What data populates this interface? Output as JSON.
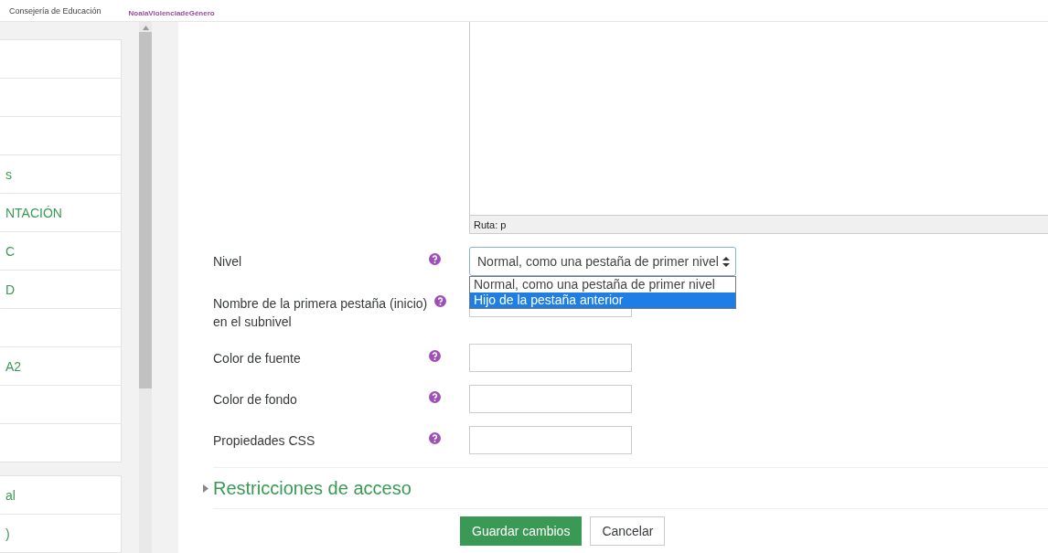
{
  "header": {
    "org": "Consejería de Educación",
    "campaign": "NoalaViolenciadeGénero"
  },
  "sidebar": {
    "panels": [
      {
        "items": [
          {
            "kind": "blank"
          },
          {
            "kind": "blank"
          },
          {
            "kind": "blank"
          },
          {
            "kind": "link",
            "label": "s"
          },
          {
            "kind": "link",
            "label": "NTACIÓN"
          },
          {
            "kind": "link",
            "label": "C"
          },
          {
            "kind": "link",
            "label": "D"
          },
          {
            "kind": "blank"
          },
          {
            "kind": "link",
            "label": "A2"
          },
          {
            "kind": "blank"
          },
          {
            "kind": "blank"
          }
        ]
      },
      {
        "items": [
          {
            "kind": "link",
            "label": "al"
          },
          {
            "kind": "link",
            "label": ")"
          }
        ]
      }
    ]
  },
  "editor": {
    "path": "Ruta: p"
  },
  "form": {
    "fields": [
      {
        "kind": "select",
        "label": "Nivel",
        "value": "Normal, como una pestaña de primer nivel",
        "expanded": true,
        "options": [
          {
            "label": "Normal, como una pestaña de primer nivel",
            "highlighted": false
          },
          {
            "label": "Hijo de la pestaña anterior",
            "highlighted": true
          }
        ]
      },
      {
        "kind": "text",
        "label": "Nombre de la primera pestaña (inicio) en el subnivel"
      },
      {
        "kind": "text",
        "label": "Color de fuente"
      },
      {
        "kind": "text",
        "label": "Color de fondo"
      },
      {
        "kind": "text",
        "label": "Propiedades CSS"
      }
    ]
  },
  "section": {
    "title": "Restricciones de acceso",
    "expanded": false
  },
  "buttons": [
    {
      "label": "Guardar cambios",
      "kind": "primary"
    },
    {
      "label": "Cancelar",
      "kind": "secondary"
    }
  ]
}
